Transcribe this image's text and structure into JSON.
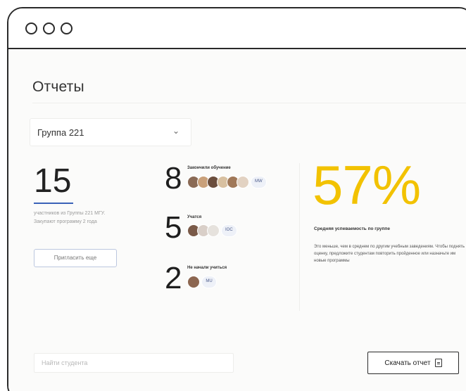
{
  "page": {
    "title": "Отчеты"
  },
  "group_select": {
    "value": "Группа 221",
    "chevron_icon": "chevron-down-icon"
  },
  "total": {
    "count": "15",
    "description": "участников из Группы 221 МГУ. Закупают программу 2 года",
    "invite_label": "Пригласить еще"
  },
  "stats": [
    {
      "count": "8",
      "label": "Закончили обучение",
      "more": "MW",
      "avatar_colors": [
        "#8a6a55",
        "#c9a07a",
        "#6b4e3d",
        "#d8c0a0",
        "#a07858",
        "#e2d2c2"
      ]
    },
    {
      "count": "5",
      "label": "Учатся",
      "more": "IOC",
      "avatar_colors": [
        "#7a5a48",
        "#d9cfc8",
        "#e6e2dd"
      ]
    },
    {
      "count": "2",
      "label": "Не начали учиться",
      "more": "MU",
      "avatar_colors": [
        "#8c6650"
      ]
    }
  ],
  "success": {
    "percent": "57%",
    "title": "Средняя успеваемость по группе",
    "description": "Это меньше, чем в среднем по другим учебным заведениям. Чтобы поднять оценку, предложите студентам повторить пройденное или назначьте им новые программы",
    "accent_color": "#f2c200"
  },
  "search": {
    "placeholder": "Найти студента"
  },
  "download": {
    "label": "Скачать отчет",
    "icon": "document-icon"
  }
}
